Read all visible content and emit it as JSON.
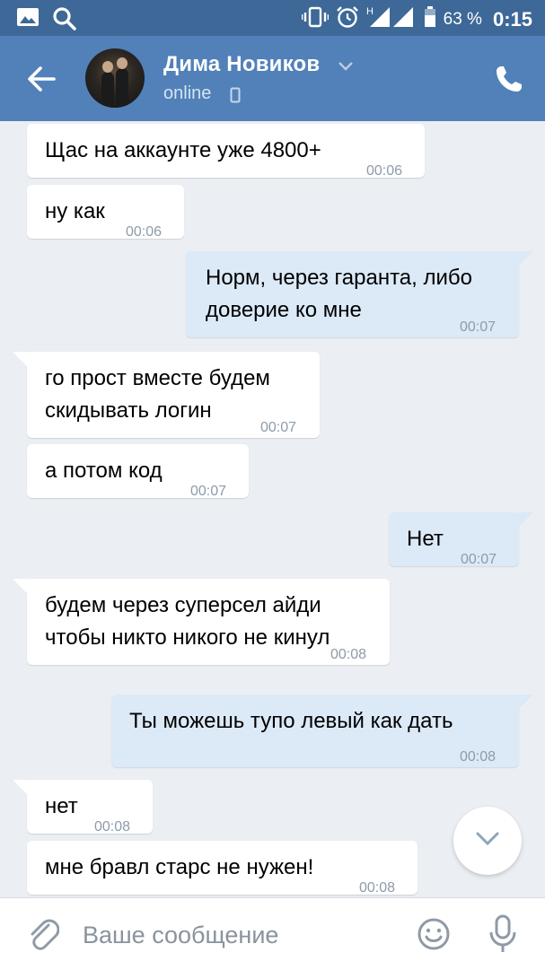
{
  "status_bar": {
    "icons": [
      "gallery-icon",
      "search-icon",
      "vibrate-icon",
      "alarm-icon",
      "signal-icon",
      "battery-icon"
    ],
    "network_label": "H",
    "battery": "63 %",
    "time": "0:15"
  },
  "header": {
    "contact_name": "Дима Новиков",
    "status": "online",
    "accent_color": "#5181b8"
  },
  "messages": [
    {
      "dir": "in",
      "text": "Щас на аккаунте уже 4800+",
      "time": "00:06"
    },
    {
      "dir": "in",
      "text": "ну как",
      "time": "00:06"
    },
    {
      "dir": "out",
      "text": "Норм, через гаранта, либо\nдоверие ко мне",
      "time": "00:07"
    },
    {
      "dir": "in",
      "text": "го прост вместе будем\nскидывать логин",
      "time": "00:07"
    },
    {
      "dir": "in",
      "text": "а потом код",
      "time": "00:07"
    },
    {
      "dir": "out",
      "text": "Нет",
      "time": "00:07"
    },
    {
      "dir": "in",
      "text": "будем через суперсел айди\nчтобы никто никого не кинул",
      "time": "00:08"
    },
    {
      "dir": "out",
      "text": "Ты можешь тупо левый как дать",
      "time": "00:08"
    },
    {
      "dir": "in",
      "text": "нет",
      "time": "00:08"
    },
    {
      "dir": "in",
      "text": "мне бравл старс не нужен!",
      "time": "00:08"
    }
  ],
  "composer": {
    "placeholder": "Ваше сообщение"
  }
}
